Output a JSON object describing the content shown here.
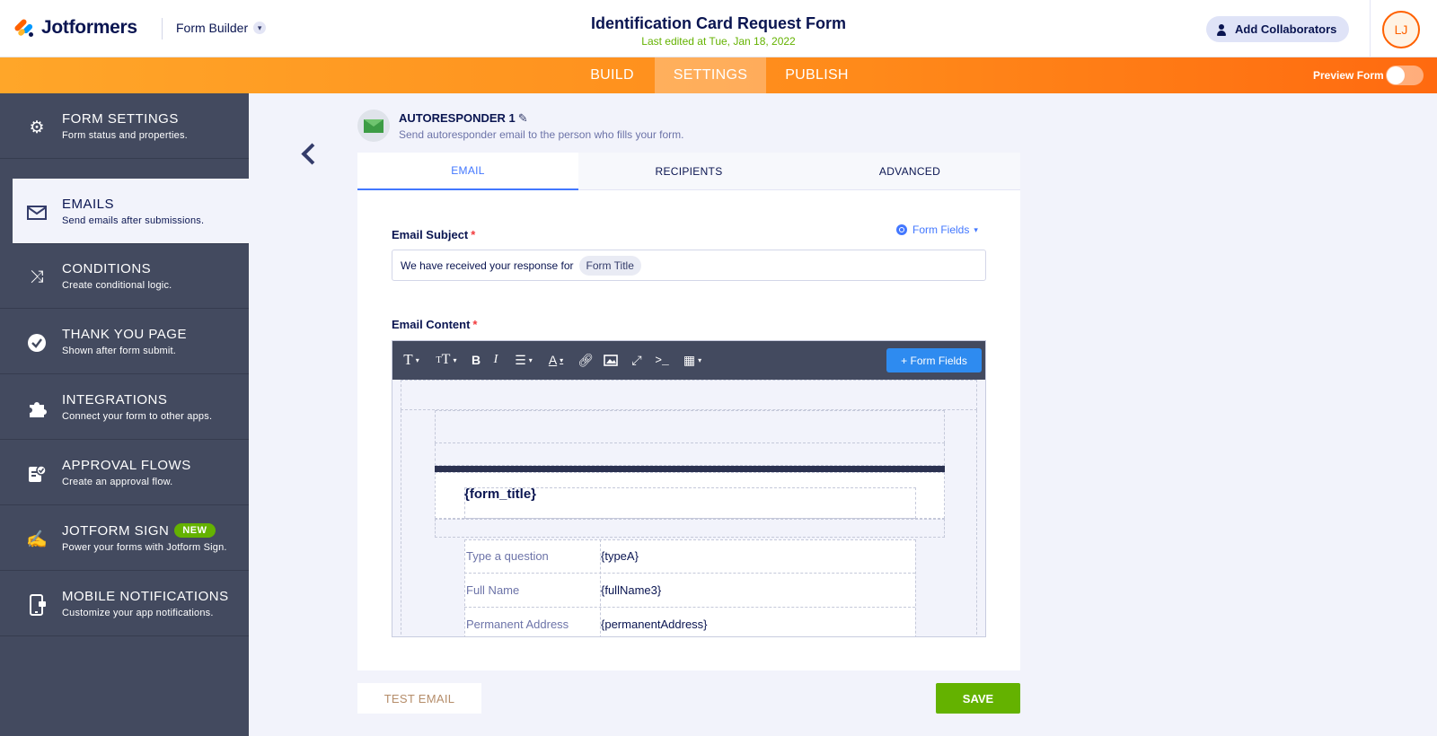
{
  "header": {
    "brand": "Jotformers",
    "builder_label": "Form Builder",
    "form_title": "Identification Card Request Form",
    "last_edited": "Last edited at Tue, Jan 18, 2022",
    "collab_label": "Add Collaborators",
    "avatar_initials": "LJ"
  },
  "nav": {
    "tabs": [
      "BUILD",
      "SETTINGS",
      "PUBLISH"
    ],
    "active_tab": "SETTINGS",
    "preview_label": "Preview Form",
    "preview_enabled": false
  },
  "sidebar": {
    "items": [
      {
        "title": "FORM SETTINGS",
        "subtitle": "Form status and properties.",
        "icon": "gear-icon"
      },
      {
        "title": "EMAILS",
        "subtitle": "Send emails after submissions.",
        "icon": "envelope-icon",
        "active": true
      },
      {
        "title": "CONDITIONS",
        "subtitle": "Create conditional logic.",
        "icon": "shuffle-icon"
      },
      {
        "title": "THANK YOU PAGE",
        "subtitle": "Shown after form submit.",
        "icon": "check-circle-icon"
      },
      {
        "title": "INTEGRATIONS",
        "subtitle": "Connect your form to other apps.",
        "icon": "puzzle-icon"
      },
      {
        "title": "APPROVAL FLOWS",
        "subtitle": "Create an approval flow.",
        "icon": "approval-icon"
      },
      {
        "title": "JOTFORM SIGN",
        "subtitle": "Power your forms with Jotform Sign.",
        "icon": "pen-sign-icon",
        "badge": "NEW"
      },
      {
        "title": "MOBILE NOTIFICATIONS",
        "subtitle": "Customize your app notifications.",
        "icon": "mobile-icon"
      }
    ]
  },
  "autoresponder": {
    "title": "AUTORESPONDER 1",
    "subtitle": "Send autoresponder email to the person who fills your form."
  },
  "email_tabs": [
    "EMAIL",
    "RECIPIENTS",
    "ADVANCED"
  ],
  "active_email_tab": "EMAIL",
  "subject": {
    "label": "Email Subject",
    "required_mark": "*",
    "form_fields_link": "Form Fields",
    "text": "We have received your response for",
    "chip": "Form Title"
  },
  "content": {
    "label": "Email Content",
    "required_mark": "*",
    "form_fields_button": "+ Form Fields",
    "form_title_placeholder": "{form_title}",
    "rows": [
      {
        "question": "Type a question",
        "value": "{typeA}"
      },
      {
        "question": "Full Name",
        "value": "{fullName3}"
      },
      {
        "question": "Permanent Address",
        "value": "{permanentAddress}"
      }
    ]
  },
  "footer": {
    "test_label": "TEST EMAIL",
    "save_label": "SAVE"
  },
  "colors": {
    "accent_orange": "#ff6100",
    "sidebar_bg": "#434a5f",
    "save_green": "#64b200",
    "link_blue": "#4277ff"
  }
}
